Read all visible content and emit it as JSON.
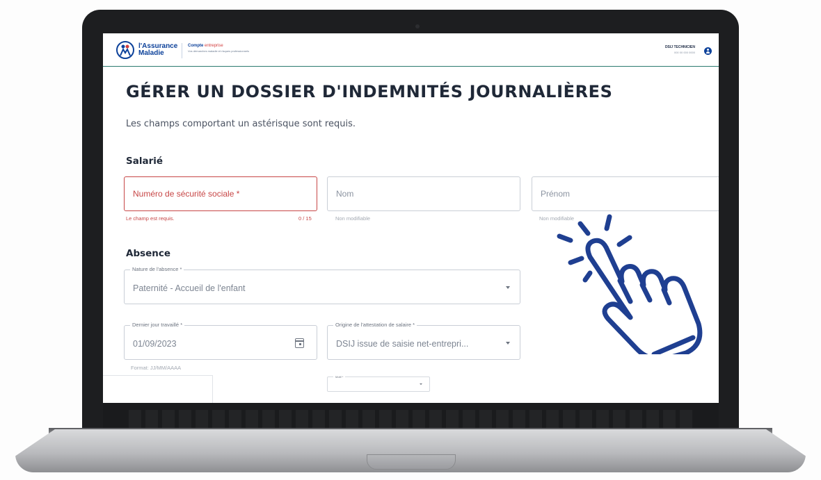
{
  "header": {
    "logo_line1": "l'Assurance",
    "logo_line2": "Maladie",
    "brand_main": "Compte",
    "brand_accent": "entreprise",
    "brand_sub": "Vos démarches maladie et risques professionnels",
    "user_name": "DSIJ TECHNICIEN",
    "user_id": "000 00 000 0000"
  },
  "page": {
    "title": "GÉRER UN DOSSIER D'INDEMNITÉS JOURNALIÈRES",
    "subtitle": "Les champs comportant un astérisque sont requis."
  },
  "salarie": {
    "heading": "Salarié",
    "nss_label": "Numéro de sécurité sociale *",
    "nss_error": "Le champ est requis.",
    "nss_counter": "0 / 15",
    "nom_label": "Nom",
    "nom_helper": "Non modifiable",
    "prenom_label": "Prénom",
    "prenom_helper": "Non modifiable"
  },
  "absence": {
    "heading": "Absence",
    "nature_label": "Nature de l'absence *",
    "nature_value": "Paternité - Accueil de l'enfant",
    "dernier_jour_label": "Dernier jour travaillé *",
    "dernier_jour_value": "01/09/2023",
    "dernier_jour_helper": "Format: JJ/MM/AAAA",
    "origine_label": "Origine de l'attestation de salaire *",
    "origine_value": "DSIJ issue de saisie net-entrepri...",
    "motif_label": "Motif *"
  },
  "colors": {
    "brand_blue": "#0c419a",
    "error_red": "#c74646",
    "hand_blue": "#1f3f91"
  },
  "icons": [
    "user-circle-icon",
    "calendar-icon",
    "chevron-down-icon",
    "pointing-hand-icon"
  ]
}
